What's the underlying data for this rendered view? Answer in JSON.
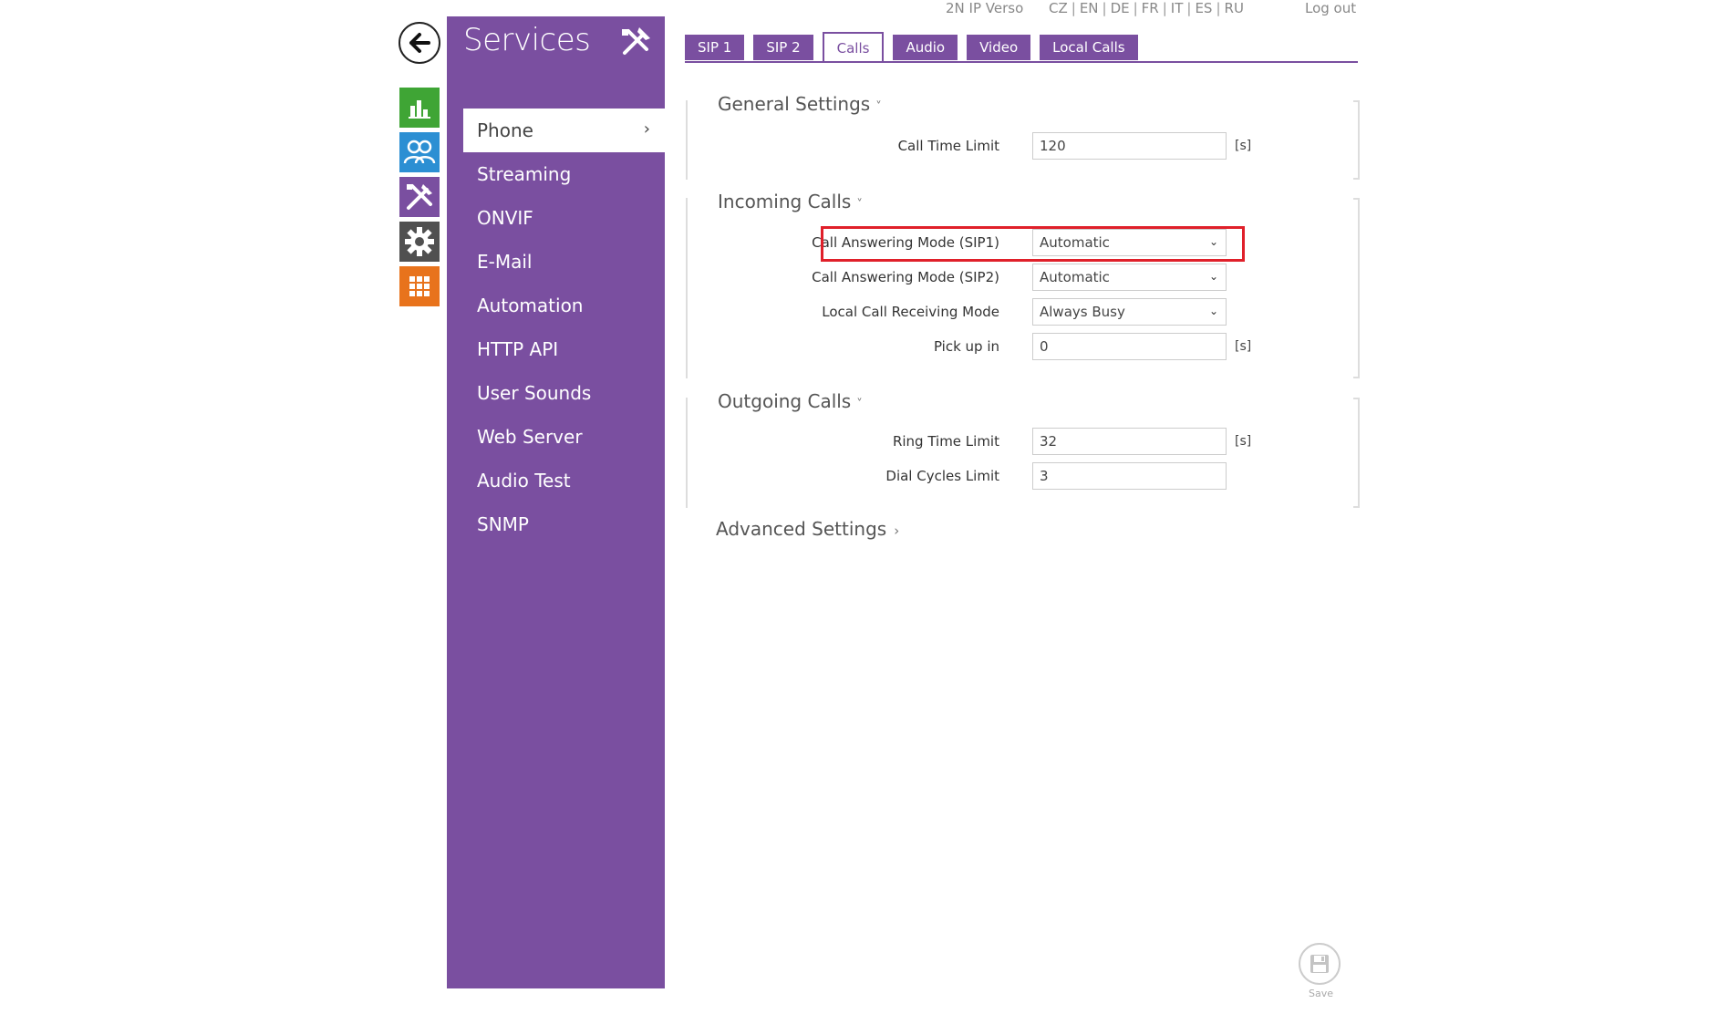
{
  "colors": {
    "purple": "#7a4fa0",
    "status_green": "#3fa535",
    "directory_blue": "#2c8fd3",
    "services_purple": "#7a4fa0",
    "system_gray": "#505050",
    "apps_orange": "#e8731c",
    "highlight_red": "#e0202a"
  },
  "rail": {
    "icons": [
      "back-arrow-icon",
      "bar-chart-icon",
      "users-icon",
      "tools-icon",
      "gear-icon",
      "grid-icon"
    ]
  },
  "sidebar": {
    "title": "Services",
    "items": [
      {
        "label": "Phone"
      },
      {
        "label": "Streaming"
      },
      {
        "label": "ONVIF"
      },
      {
        "label": "E-Mail"
      },
      {
        "label": "Automation"
      },
      {
        "label": "HTTP API"
      },
      {
        "label": "User Sounds"
      },
      {
        "label": "Web Server"
      },
      {
        "label": "Audio Test"
      },
      {
        "label": "SNMP"
      }
    ]
  },
  "header": {
    "device": "2N IP Verso",
    "languages": [
      "CZ",
      "EN",
      "DE",
      "FR",
      "IT",
      "ES",
      "RU"
    ],
    "logout": "Log out"
  },
  "tabs": [
    {
      "label": "SIP 1"
    },
    {
      "label": "SIP 2"
    },
    {
      "label": "Calls"
    },
    {
      "label": "Audio"
    },
    {
      "label": "Video"
    },
    {
      "label": "Local Calls"
    }
  ],
  "general": {
    "title": "General Settings",
    "call_time_limit": {
      "label": "Call Time Limit",
      "value": "120",
      "unit": "[s]"
    }
  },
  "incoming": {
    "title": "Incoming Calls",
    "sip1_mode": {
      "label": "Call Answering Mode (SIP1)",
      "value": "Automatic"
    },
    "sip2_mode": {
      "label": "Call Answering Mode (SIP2)",
      "value": "Automatic"
    },
    "local_mode": {
      "label": "Local Call Receiving Mode",
      "value": "Always Busy"
    },
    "pickup": {
      "label": "Pick up in",
      "value": "0",
      "unit": "[s]"
    }
  },
  "outgoing": {
    "title": "Outgoing Calls",
    "ring_limit": {
      "label": "Ring Time Limit",
      "value": "32",
      "unit": "[s]"
    },
    "dial_cycles": {
      "label": "Dial Cycles Limit",
      "value": "3"
    }
  },
  "advanced": {
    "title": "Advanced Settings"
  },
  "save": {
    "label": "Save"
  }
}
